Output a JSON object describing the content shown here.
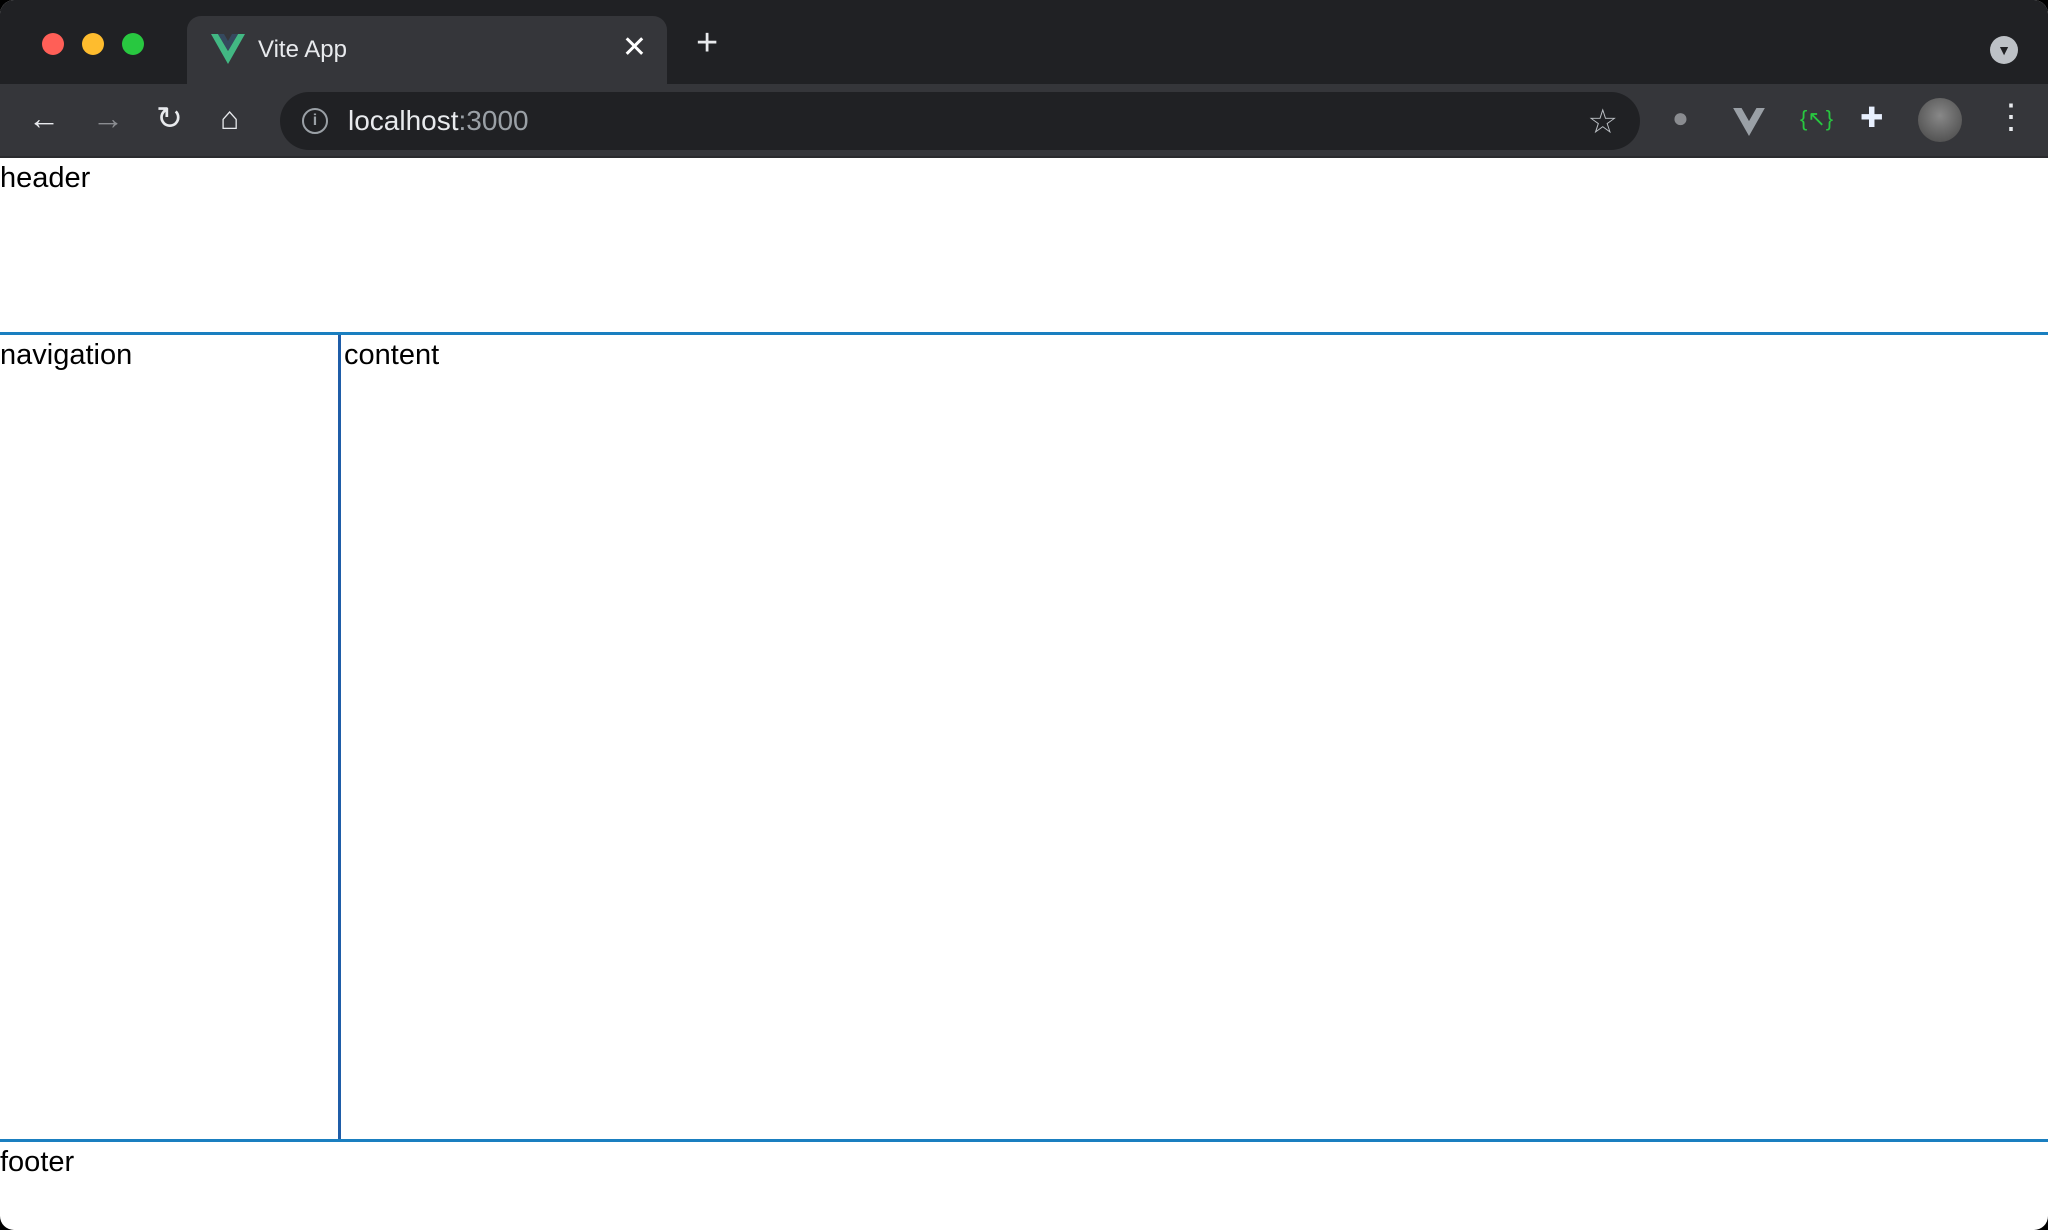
{
  "browser": {
    "tab_title": "Vite App",
    "close_tab": "✕",
    "new_tab": "+",
    "url_host": "localhost",
    "url_port": ":3000",
    "icons": [
      "back-icon",
      "forward-icon",
      "reload-icon",
      "home-icon",
      "info-icon",
      "star-icon",
      "bug-extension-icon",
      "vue-devtools-icon",
      "json-extension-icon",
      "puzzle-icon",
      "avatar",
      "more-icon"
    ]
  },
  "page": {
    "header": "header",
    "navigation": "navigation",
    "content": "content",
    "footer": "footer"
  },
  "colors": {
    "accent": "#1a7fc0",
    "divider": "#1f5da8",
    "vue_green": "#42b883"
  }
}
